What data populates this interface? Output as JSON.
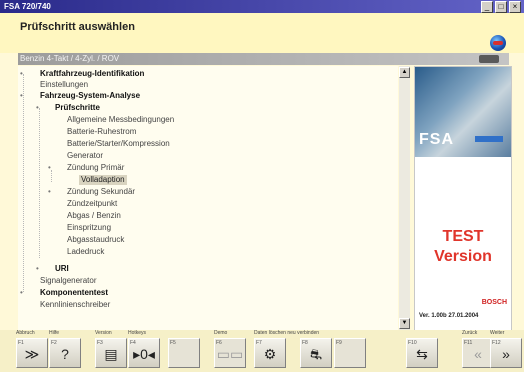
{
  "window": {
    "title": "FSA 720/740",
    "min_label": "_",
    "max_label": "□",
    "close_label": "×"
  },
  "header": {
    "title": "Prüfschritt auswählen",
    "icon": "globe-icon"
  },
  "pathbar": {
    "text": "Benzin 4-Takt /  4-Zyl. / ROV"
  },
  "tree": [
    {
      "label": "Kraftfahrzeug-Identifikation",
      "bold": true,
      "expander": "+"
    },
    {
      "label": "Einstellungen"
    },
    {
      "label": "Fahrzeug-System-Analyse",
      "bold": true,
      "expander": "-"
    },
    {
      "label": "Prüfschritte",
      "bold": true,
      "expander": "-"
    },
    {
      "label": "Allgemeine Messbedingungen"
    },
    {
      "label": "Batterie-Ruhestrom"
    },
    {
      "label": "Batterie/Starter/Kompression"
    },
    {
      "label": "Generator"
    },
    {
      "label": "Zündung Primär",
      "expander": "-"
    },
    {
      "label": "Volladaption",
      "selected": true
    },
    {
      "label": "Zündung Sekundär",
      "expander": "+"
    },
    {
      "label": "Zündzeitpunkt"
    },
    {
      "label": "Abgas / Benzin"
    },
    {
      "label": "Einspritzung"
    },
    {
      "label": "Abgasstaudruck"
    },
    {
      "label": "Ladedruck"
    },
    {
      "label": "URI",
      "bold": true,
      "expander": "+"
    },
    {
      "label": "Signalgenerator"
    },
    {
      "label": "Komponententest",
      "bold": true,
      "expander": "+"
    },
    {
      "label": "Kennlinienschreiber"
    }
  ],
  "panel": {
    "brand": "FSA",
    "test_line1": "TEST",
    "test_line2": "Version",
    "maker": "BOSCH",
    "version": "Ver. 1.00b 27.01.2004"
  },
  "fkeys": [
    {
      "label": "Abbruch",
      "num": "F1",
      "glyph": "≫",
      "icon": "chevrons-up-icon",
      "enabled": true
    },
    {
      "label": "Hilfe",
      "num": "F2",
      "glyph": "?",
      "icon": "help-icon",
      "enabled": true
    },
    {
      "label": "Version",
      "num": "F3",
      "glyph": "▤",
      "icon": "document-icon",
      "enabled": true
    },
    {
      "label": "Hotkeys",
      "num": "F4",
      "glyph": "▸0◂",
      "icon": "hotkeys-icon",
      "enabled": true
    },
    {
      "label": "",
      "num": "F5",
      "glyph": "",
      "icon": "empty",
      "enabled": false
    },
    {
      "label": "Demo",
      "num": "F6",
      "glyph": "▭▭",
      "icon": "demo-icon",
      "enabled": false
    },
    {
      "label": "Daten löschen neu verbinden",
      "num": "F7",
      "glyph": "⚙",
      "icon": "reconnect-icon",
      "enabled": true
    },
    {
      "label": "",
      "num": "F8",
      "glyph": "⛐",
      "icon": "vehicle-icon",
      "enabled": true
    },
    {
      "label": "",
      "num": "F9",
      "glyph": "",
      "icon": "empty",
      "enabled": false
    },
    {
      "label": "F10",
      "num": "F10",
      "glyph": "⇆",
      "icon": "print-icon",
      "enabled": true
    },
    {
      "label": "Zurück",
      "num": "F11",
      "glyph": "«",
      "icon": "back-icon",
      "enabled": false
    },
    {
      "label": "Weiter",
      "num": "F12",
      "glyph": "»",
      "icon": "forward-icon",
      "enabled": true
    }
  ]
}
